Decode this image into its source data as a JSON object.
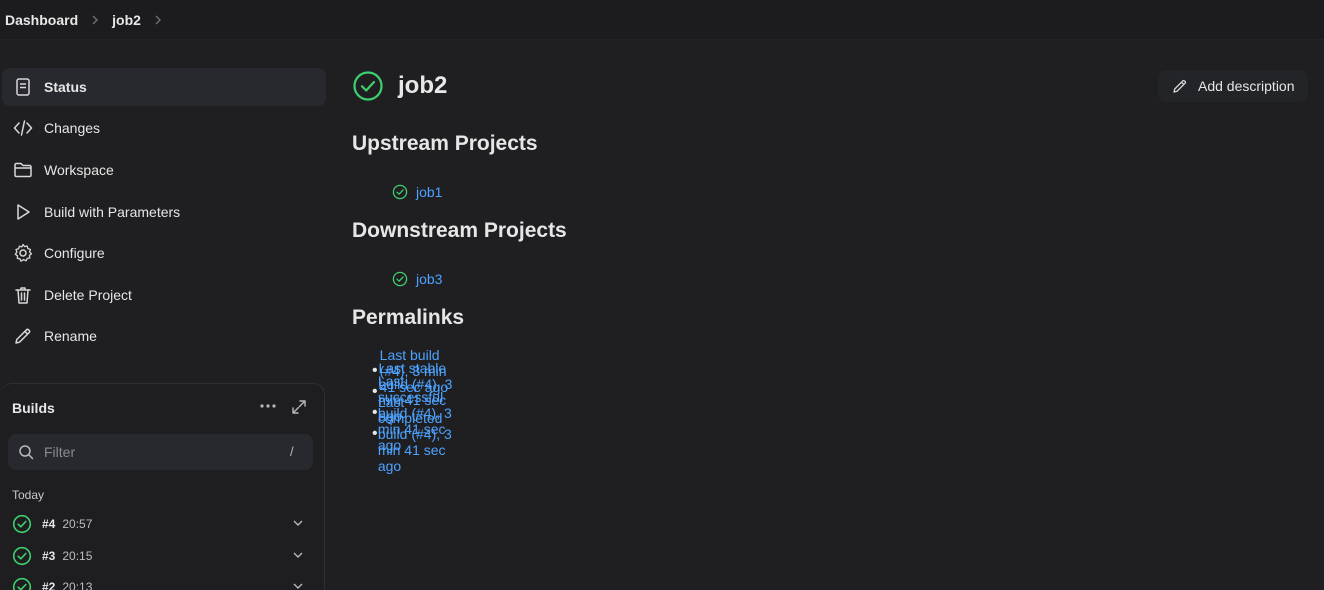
{
  "breadcrumb": {
    "items": [
      "Dashboard",
      "job2"
    ]
  },
  "sidebar": {
    "items": [
      {
        "label": "Status",
        "icon": "document-icon",
        "active": true
      },
      {
        "label": "Changes",
        "icon": "code-icon"
      },
      {
        "label": "Workspace",
        "icon": "folder-icon"
      },
      {
        "label": "Build with Parameters",
        "icon": "play-icon"
      },
      {
        "label": "Configure",
        "icon": "gear-icon"
      },
      {
        "label": "Delete Project",
        "icon": "trash-icon"
      },
      {
        "label": "Rename",
        "icon": "pencil-icon"
      }
    ]
  },
  "builds": {
    "title": "Builds",
    "filter_placeholder": "Filter",
    "filter_shortcut": "/",
    "group_label": "Today",
    "rows": [
      {
        "number": "#4",
        "time": "20:57",
        "status": "success"
      },
      {
        "number": "#3",
        "time": "20:15",
        "status": "success"
      },
      {
        "number": "#2",
        "time": "20:13",
        "status": "success"
      }
    ]
  },
  "main": {
    "title": "job2",
    "status": "success",
    "add_description_label": "Add description",
    "upstream": {
      "heading": "Upstream Projects",
      "projects": [
        "job1"
      ]
    },
    "downstream": {
      "heading": "Downstream Projects",
      "projects": [
        "job3"
      ]
    },
    "permalinks": {
      "heading": "Permalinks",
      "links": [
        "Last build (#4), 3 min 41 sec ago",
        "Last stable build (#4), 3 min 41 sec ago",
        "Last successful build (#4), 3 min 41 sec ago",
        "Last completed build (#4), 3 min 41 sec ago"
      ]
    }
  },
  "colors": {
    "success": "#3ecf6e",
    "link": "#4da3ff",
    "background": "#1f1f22"
  }
}
